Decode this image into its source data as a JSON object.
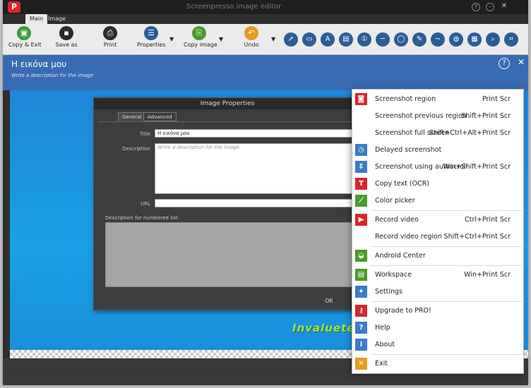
{
  "window": {
    "title": "Screenpresso image editor",
    "logo": "P"
  },
  "tabs": [
    {
      "label": "Main",
      "active": true
    },
    {
      "label": "Image",
      "active": false
    }
  ],
  "ribbon": {
    "buttons": [
      {
        "label": "Copy & Exit",
        "icon": "save-exit-icon",
        "color": "#3e9b3e"
      },
      {
        "label": "Save as",
        "icon": "floppy-icon",
        "color": "#2b2b2b"
      },
      {
        "label": "Print",
        "icon": "printer-icon",
        "color": "#2b2b2b"
      },
      {
        "label": "Properties",
        "icon": "list-icon",
        "color": "#2b5c98"
      },
      {
        "label": "Copy image",
        "icon": "clipboard-icon",
        "color": "#4c9a2a"
      },
      {
        "label": "Undo",
        "icon": "undo-icon",
        "color": "#e69a1e"
      }
    ],
    "tools": [
      "arrow-icon",
      "rectangle-icon",
      "text-icon",
      "button-icon",
      "number-icon",
      "line-icon",
      "ellipse-icon",
      "highlight-icon",
      "freehand-icon",
      "blur-icon",
      "image-icon",
      "magnifier-icon",
      "crop-icon"
    ]
  },
  "canvas": {
    "image_title": "Η εικόνα μου",
    "description_placeholder": "Write a description for the image",
    "watermark": "Invaluetech"
  },
  "dialog": {
    "title": "Image Properties",
    "tabs": [
      "General",
      "Advanced"
    ],
    "title_label": "Title",
    "title_value": "Η εικόνα μου",
    "description_label": "Description",
    "description_placeholder": "Write a description for the image",
    "url_label": "URL",
    "url_value": "",
    "numbered_list_label": "Description for numbered list:",
    "ok_label": "OK"
  },
  "menu": {
    "items": [
      {
        "label": "Screenshot region",
        "shortcut": "Print Scr",
        "icon": "camera-icon",
        "color": "#d9262a"
      },
      {
        "label": "Screenshot previous region",
        "shortcut": "Shift+Print Scr",
        "icon": "",
        "color": ""
      },
      {
        "label": "Screenshot full screen",
        "shortcut": "Shift+Ctrl+Alt+Print Scr",
        "icon": "",
        "color": ""
      },
      {
        "label": "Delayed screenshot",
        "shortcut": "",
        "icon": "timer-icon",
        "color": "#3a7bc8"
      },
      {
        "label": "Screenshot using autoscroll",
        "shortcut": "Win+Shift+Print Scr",
        "icon": "autoscroll-icon",
        "color": "#3a7bc8"
      },
      {
        "label": "Copy text (OCR)",
        "shortcut": "",
        "icon": "ocr-icon",
        "color": "#d9262a"
      },
      {
        "label": "Color picker",
        "shortcut": "",
        "icon": "eyedropper-icon",
        "color": "#4c9a2a"
      },
      {
        "label": "Record video",
        "shortcut": "Ctrl+Print Scr",
        "icon": "video-camera-icon",
        "color": "#d9262a"
      },
      {
        "label": "Record video region",
        "shortcut": "Shift+Ctrl+Print Scr",
        "icon": "",
        "color": ""
      },
      {
        "label": "Android Center",
        "shortcut": "",
        "icon": "android-icon",
        "color": "#4c9a2a"
      },
      {
        "label": "Workspace",
        "shortcut": "Win+Print Scr",
        "icon": "workspace-icon",
        "color": "#4c9a2a"
      },
      {
        "label": "Settings",
        "shortcut": "",
        "icon": "wrench-icon",
        "color": "#3a7bc8"
      },
      {
        "label": "Upgrade to PRO!",
        "shortcut": "",
        "icon": "key-icon",
        "color": "#d9262a"
      },
      {
        "label": "Help",
        "shortcut": "",
        "icon": "question-icon",
        "color": "#3a7bc8"
      },
      {
        "label": "About",
        "shortcut": "",
        "icon": "info-icon",
        "color": "#3a7bc8"
      },
      {
        "label": "Exit",
        "shortcut": "",
        "icon": "close-icon",
        "color": "#e69a1e"
      }
    ]
  }
}
